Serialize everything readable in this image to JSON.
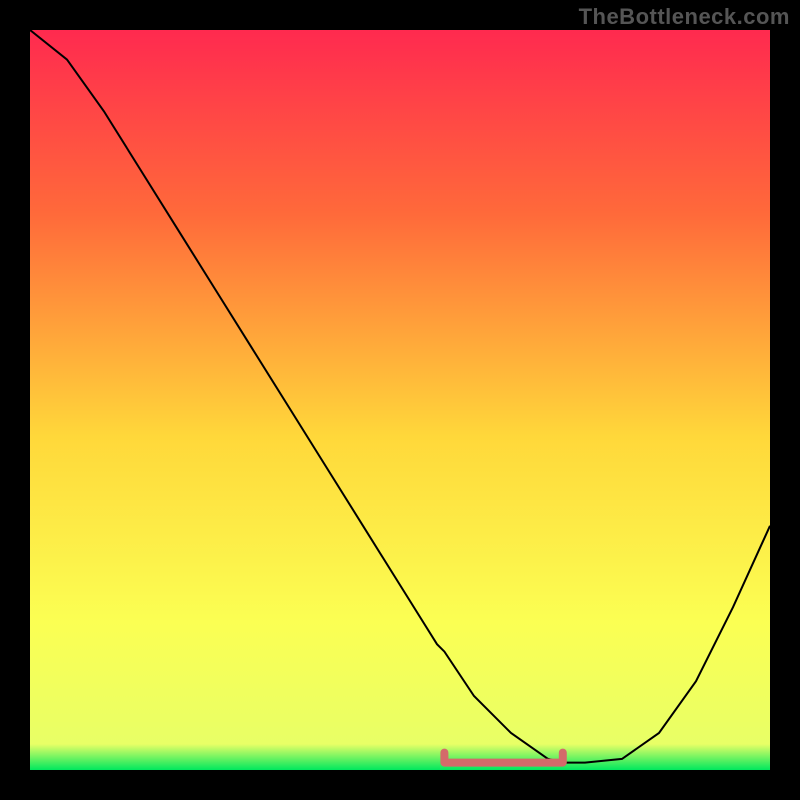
{
  "watermark": "TheBottleneck.com",
  "colors": {
    "frame": "#000000",
    "grad_top": "#ff2a4f",
    "grad_mid1": "#ff6a3a",
    "grad_mid2": "#ffd83a",
    "grad_yellow": "#fbff53",
    "grad_green": "#00e85e",
    "curve": "#000000",
    "highlight": "#d46a6a"
  },
  "grad_stops": [
    {
      "offset": 0.0,
      "color": "#ff2a4f"
    },
    {
      "offset": 0.25,
      "color": "#ff6a3a"
    },
    {
      "offset": 0.55,
      "color": "#ffd83a"
    },
    {
      "offset": 0.8,
      "color": "#fbff53"
    },
    {
      "offset": 0.965,
      "color": "#e8ff66"
    },
    {
      "offset": 1.0,
      "color": "#00e85e"
    }
  ],
  "chart_data": {
    "type": "line",
    "title": "",
    "xlabel": "",
    "ylabel": "",
    "xlim": [
      0,
      100
    ],
    "ylim": [
      0,
      100
    ],
    "x": [
      0,
      5,
      10,
      15,
      20,
      25,
      30,
      35,
      40,
      45,
      50,
      55,
      56,
      60,
      65,
      70,
      72,
      75,
      80,
      85,
      90,
      95,
      100
    ],
    "y": [
      100,
      96,
      89,
      81,
      73,
      65,
      57,
      49,
      41,
      33,
      25,
      17,
      16,
      10,
      5,
      1.5,
      1,
      1,
      1.5,
      5,
      12,
      22,
      33
    ],
    "highlight_segment": {
      "x_start": 56,
      "x_end": 72,
      "y": 1
    }
  }
}
